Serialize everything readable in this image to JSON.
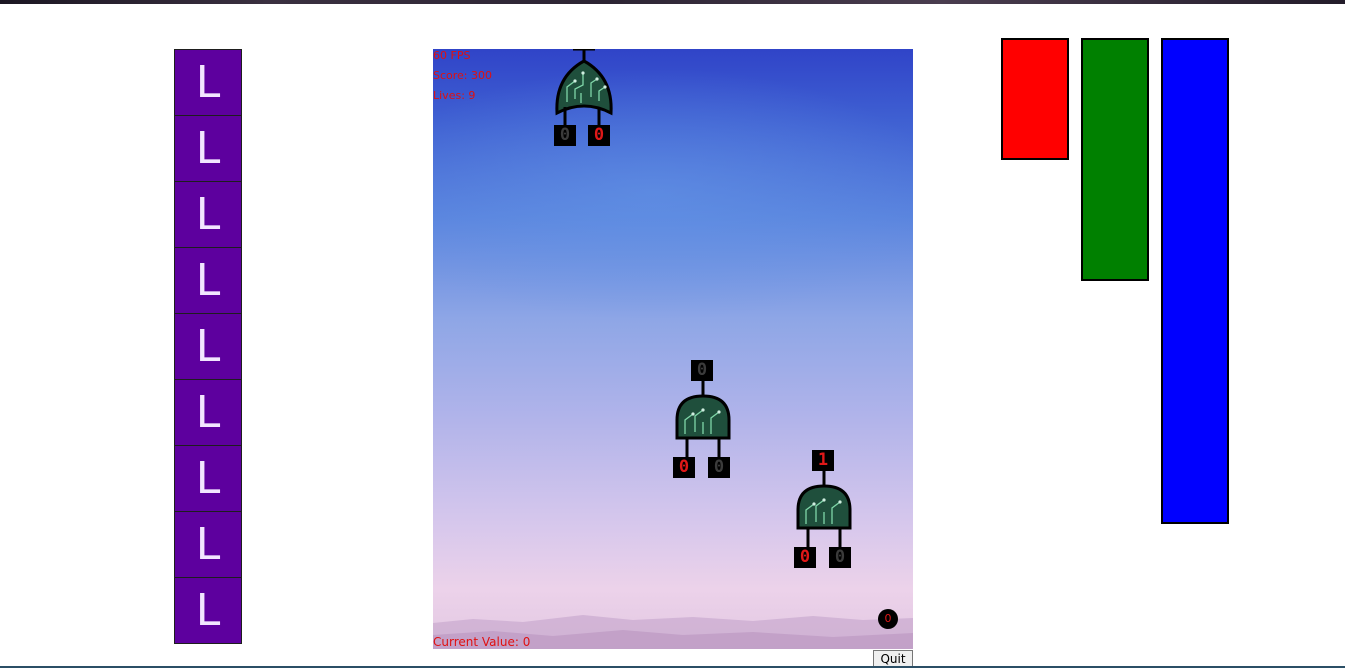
{
  "tiles": [
    "L",
    "L",
    "L",
    "L",
    "L",
    "L",
    "L",
    "L",
    "L"
  ],
  "hud": {
    "fps": "60 FPS",
    "score": "Score: 300",
    "lives": "Lives: 9"
  },
  "gates": [
    {
      "name": "or-gate",
      "output": null,
      "inputs": [
        "0",
        "0"
      ],
      "inputs_lit": [
        false,
        true
      ]
    },
    {
      "name": "and-gate",
      "output": "0",
      "output_lit": false,
      "inputs": [
        "0",
        "0"
      ],
      "inputs_lit": [
        true,
        false
      ]
    },
    {
      "name": "and-gate",
      "output": "1",
      "output_lit": true,
      "inputs": [
        "0",
        "0"
      ],
      "inputs_lit": [
        true,
        false
      ]
    }
  ],
  "current_value": "Current Value:  0",
  "orb_value": "0",
  "quit_label": "Quit",
  "bars": [
    {
      "name": "red-bar",
      "color": "#ff0000",
      "level": 0.25
    },
    {
      "name": "green-bar",
      "color": "#008000",
      "level": 0.5
    },
    {
      "name": "blue-bar",
      "color": "#0000ff",
      "level": 1.0
    }
  ],
  "colors": {
    "tile": "#5d009e",
    "hud_text": "#e01010",
    "gate_fill": "#1f4f3c"
  }
}
